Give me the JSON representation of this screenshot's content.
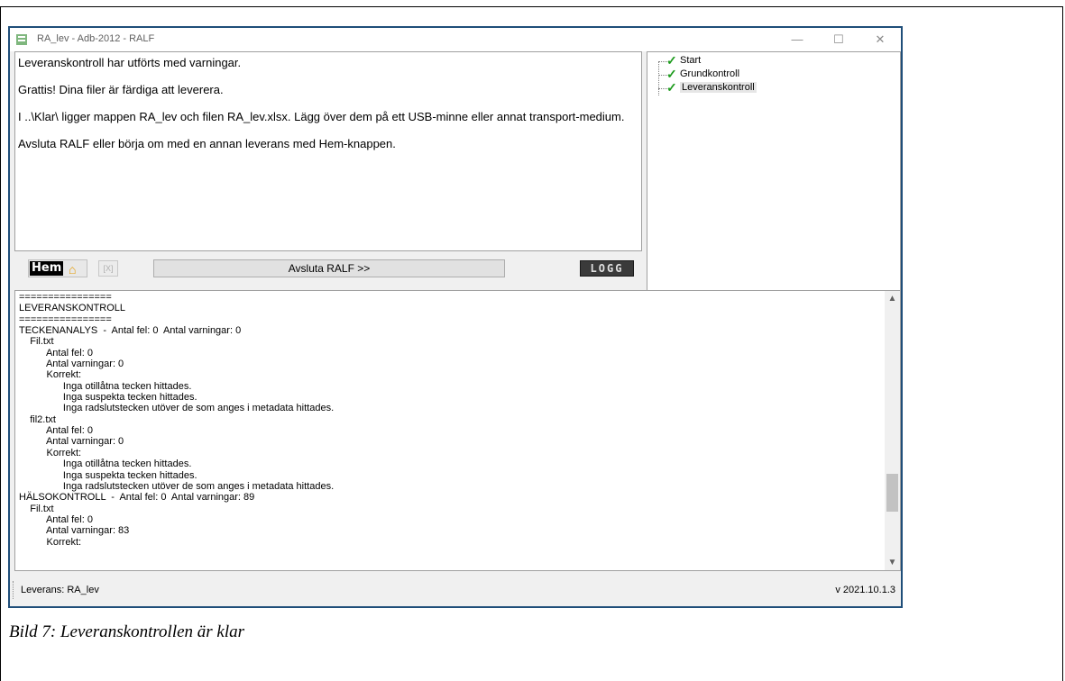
{
  "window": {
    "title": "RA_lev - Adb-2012 - RALF",
    "minimize": "—",
    "maximize": "☐",
    "close": "✕"
  },
  "message": {
    "line1": "Leveranskontroll har utförts med varningar.",
    "line2": "Grattis! Dina filer är färdiga att leverera.",
    "line3": "I ..\\Klar\\ ligger mappen RA_lev och filen RA_lev.xlsx. Lägg över dem på ett USB-minne eller annat transport-medium.",
    "line4": "Avsluta RALF eller börja om med en annan leverans med Hem-knappen."
  },
  "tree": {
    "items": [
      {
        "label": "Start",
        "icon": "check-icon"
      },
      {
        "label": "Grundkontroll",
        "icon": "check-icon"
      },
      {
        "label": "Leveranskontroll",
        "icon": "check-icon"
      }
    ]
  },
  "toolbar": {
    "hem_label": "Hem",
    "avsluta_label": "Avsluta RALF >>",
    "logg_label": "LOGG",
    "export_label": "[X]"
  },
  "log": {
    "lines": [
      "================",
      "LEVERANSKONTROLL",
      "================",
      "TECKENANALYS  -  Antal fel: 0  Antal varningar: 0",
      "    Fil.txt",
      "          Antal fel: 0",
      "          Antal varningar: 0",
      "          Korrekt:",
      "                Inga otillåtna tecken hittades.",
      "                Inga suspekta tecken hittades.",
      "                Inga radslutstecken utöver de som anges i metadata hittades.",
      "    fil2.txt",
      "          Antal fel: 0",
      "          Antal varningar: 0",
      "          Korrekt:",
      "                Inga otillåtna tecken hittades.",
      "                Inga suspekta tecken hittades.",
      "                Inga radslutstecken utöver de som anges i metadata hittades.",
      "HÄLSOKONTROLL  -  Antal fel: 0  Antal varningar: 89",
      "    Fil.txt",
      "          Antal fel: 0",
      "          Antal varningar: 83",
      "          Korrekt:"
    ]
  },
  "status": {
    "left": "Leverans: RA_lev",
    "right": "v 2021.10.1.3"
  },
  "caption": "Bild 7: Leveranskontrollen är klar",
  "colors": {
    "window_border": "#1f4e79",
    "check": "#1c9b1c",
    "house": "#e59a00"
  }
}
